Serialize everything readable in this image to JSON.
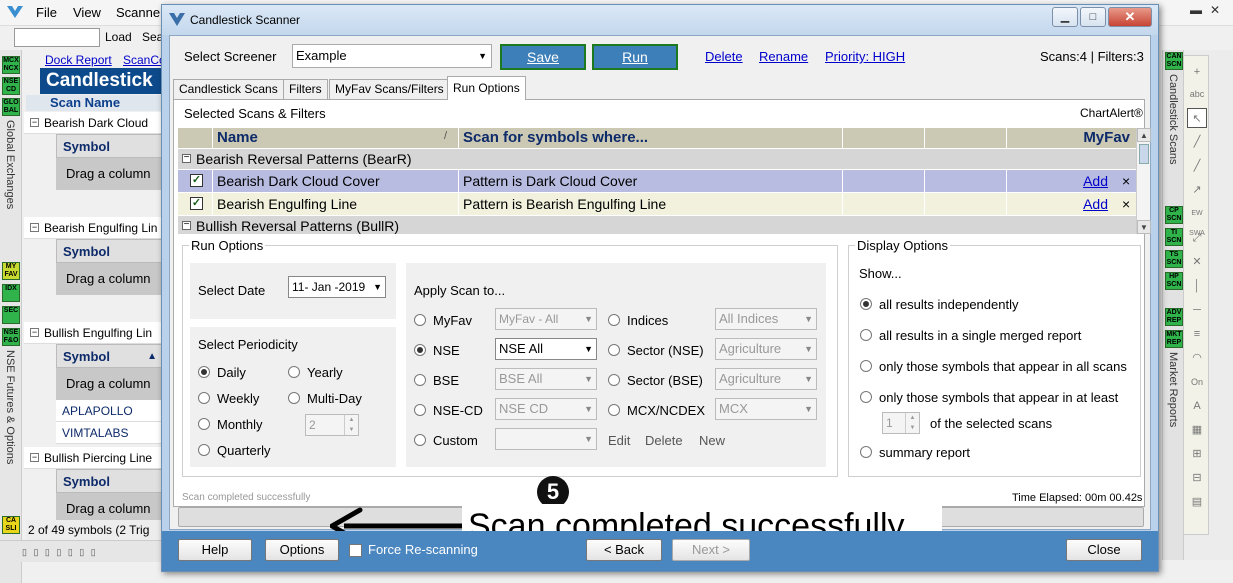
{
  "background": {
    "menu": [
      "File",
      "View",
      "Scanner"
    ],
    "search_btn": "Load",
    "search_btn2": "Sea",
    "links": [
      "Dock Report",
      "ScanCo"
    ],
    "title": "Candlestick",
    "scan_name_header": "Scan Name",
    "left_icons": [
      "MCX NCX",
      "NSE CD",
      "GLO BAL",
      "MY FAV",
      "IDX",
      "SEC",
      "NSE F&O",
      "CA SLI"
    ],
    "left_vertical_labels": [
      "Global Exchanges",
      "NSE Futures & Options"
    ],
    "sections": [
      {
        "label": "Bearish Dark Cloud",
        "symbol_header": "Symbol",
        "drag_text": "Drag a column",
        "rows": []
      },
      {
        "label": "Bearish Engulfing Lin",
        "symbol_header": "Symbol",
        "drag_text": "Drag a column",
        "rows": []
      },
      {
        "label": "Bullish Engulfing Lin",
        "symbol_header": "Symbol",
        "drag_text": "Drag a column",
        "rows": [
          "APLAPOLLO",
          "VIMTALABS"
        ]
      },
      {
        "label": "Bullish Piercing Line",
        "symbol_header": "Symbol",
        "drag_text": "Drag a column",
        "rows": []
      }
    ],
    "status": "2 of 49 symbols (2 Trig",
    "right_icons": [
      "CAN SCN",
      "CP SCN",
      "TI SCN",
      "TS SCN",
      "HP SCN",
      "ADV REP",
      "MKT REP"
    ],
    "right_vertical_labels": [
      "Candlestick Scans",
      "Market Reports"
    ],
    "tool_labels": [
      "abc",
      "EW SWA",
      "On"
    ]
  },
  "dialog": {
    "title": "Candlestick Scanner",
    "select_screener_label": "Select Screener",
    "screener_value": "Example",
    "save_label": "Save",
    "run_label": "Run",
    "delete_label": "Delete",
    "rename_label": "Rename",
    "priority_label": "Priority: HIGH",
    "scans_info": "Scans:4 | Filters:3",
    "tabs": [
      "Candlestick Scans",
      "Filters",
      "MyFav Scans/Filters",
      "Run Options"
    ],
    "selected_label": "Selected Scans & Filters",
    "chartalert": "ChartAlert®",
    "grid": {
      "col_name": "Name",
      "col_where": "Scan for symbols where...",
      "col_myfav": "MyFav",
      "group1": "Bearish Reversal Patterns (BearR)",
      "rows": [
        {
          "name": "Bearish Dark Cloud Cover",
          "where": "Pattern is Dark Cloud Cover",
          "myfav": "Add",
          "close": "×"
        },
        {
          "name": "Bearish Engulfing Line",
          "where": "Pattern is Bearish Engulfing Line",
          "myfav": "Add",
          "close": "×"
        }
      ],
      "group2": "Bullish Reversal Patterns (BullR)"
    },
    "run_options": {
      "title": "Run Options",
      "select_date_label": "Select Date",
      "date_value": "11- Jan -2019",
      "periodicity_label": "Select Periodicity",
      "periods": [
        "Daily",
        "Weekly",
        "Monthly",
        "Quarterly"
      ],
      "periods2": [
        "Yearly",
        "Multi-Day"
      ],
      "multiday_value": "2",
      "apply_label": "Apply Scan to...",
      "apply_left": [
        {
          "label": "MyFav",
          "value": "MyFav - All"
        },
        {
          "label": "NSE",
          "value": "NSE All"
        },
        {
          "label": "BSE",
          "value": "BSE All"
        },
        {
          "label": "NSE-CD",
          "value": "NSE CD"
        },
        {
          "label": "Custom",
          "value": ""
        }
      ],
      "apply_right": [
        {
          "label": "Indices",
          "value": "All Indices"
        },
        {
          "label": "Sector (NSE)",
          "value": "Agriculture"
        },
        {
          "label": "Sector (BSE)",
          "value": "Agriculture"
        },
        {
          "label": "MCX/NCDEX",
          "value": "MCX"
        }
      ],
      "custom_links": [
        "Edit",
        "Delete",
        "New"
      ]
    },
    "display_options": {
      "title": "Display Options",
      "show_label": "Show...",
      "options": [
        "all results independently",
        "all results in a single merged report",
        "only those symbols that appear in all scans",
        "only those symbols that appear in at least"
      ],
      "atleast_value": "1",
      "atleast_suffix": "of the selected scans",
      "summary": "summary report"
    },
    "status_text": "Scan completed successfully",
    "elapsed": "Time Elapsed: 00m 00.42s",
    "annotation_number": "5",
    "annotation_text": "Scan completed successfully",
    "footer": {
      "help": "Help",
      "options": "Options",
      "force": "Force Re-scanning",
      "back": "< Back",
      "next": "Next >",
      "close": "Close"
    }
  }
}
